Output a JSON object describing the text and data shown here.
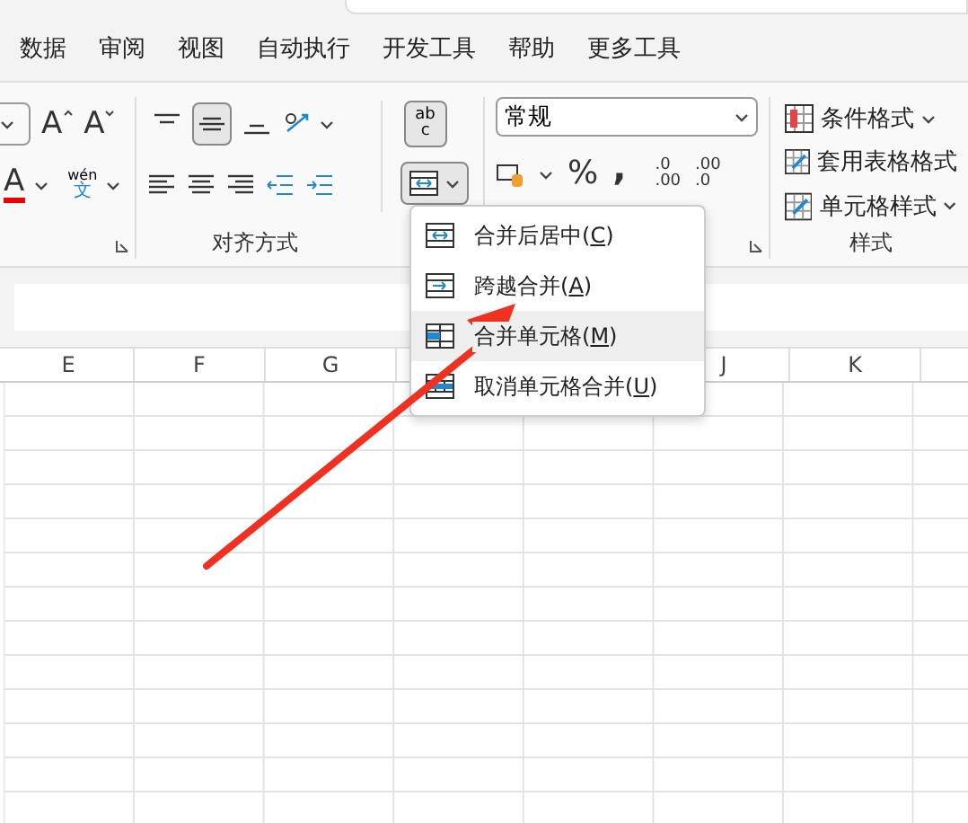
{
  "tabs": [
    {
      "label": "数据",
      "selected": false
    },
    {
      "label": "审阅",
      "selected": false
    },
    {
      "label": "视图",
      "selected": false
    },
    {
      "label": "自动执行",
      "selected": false
    },
    {
      "label": "开发工具",
      "selected": false
    },
    {
      "label": "帮助",
      "selected": false
    },
    {
      "label": "更多工具",
      "selected": false
    }
  ],
  "font_group": {
    "grow_glyph": "A",
    "shrink_glyph": "A",
    "color_glyph": "A",
    "phonetic_top": "wén",
    "phonetic_bottom": "文"
  },
  "alignment_group": {
    "label": "对齐方式",
    "buttons": [
      {
        "kind": "top",
        "selected": false
      },
      {
        "kind": "middle",
        "selected": true
      },
      {
        "kind": "bottom",
        "selected": false
      }
    ],
    "wrap_glyph_top": "ab",
    "wrap_glyph_bottom": "c",
    "merge_expanded": true
  },
  "number_group": {
    "format": "常规",
    "percent": "%",
    "comma": ",",
    "decimal_more": [
      ".0",
      ".00"
    ],
    "decimal_less": [
      ".00",
      ".0"
    ]
  },
  "styles_group": {
    "label": "样式",
    "items": [
      {
        "label": "条件格式",
        "kind": "conditional",
        "dropdown": true
      },
      {
        "label": "套用表格格式",
        "kind": "table",
        "dropdown": false
      },
      {
        "label": "单元格样式",
        "kind": "cell",
        "dropdown": true
      }
    ]
  },
  "columns": [
    {
      "label": "E"
    },
    {
      "label": "F"
    },
    {
      "label": "G"
    },
    {},
    {},
    {
      "label": "J"
    },
    {
      "label": "K"
    }
  ],
  "merge_menu": [
    {
      "kind": "center",
      "text": "合并后居中(",
      "key": "C",
      "end": ")",
      "selected": false
    },
    {
      "kind": "across",
      "text": "跨越合并(",
      "key": "A",
      "end": ")",
      "selected": false
    },
    {
      "kind": "merge",
      "text": "合并单元格(",
      "key": "M",
      "end": ")",
      "selected": true
    },
    {
      "kind": "unmerge",
      "text": "取消单元格合并(",
      "key": "U",
      "end": ")",
      "selected": false
    }
  ]
}
